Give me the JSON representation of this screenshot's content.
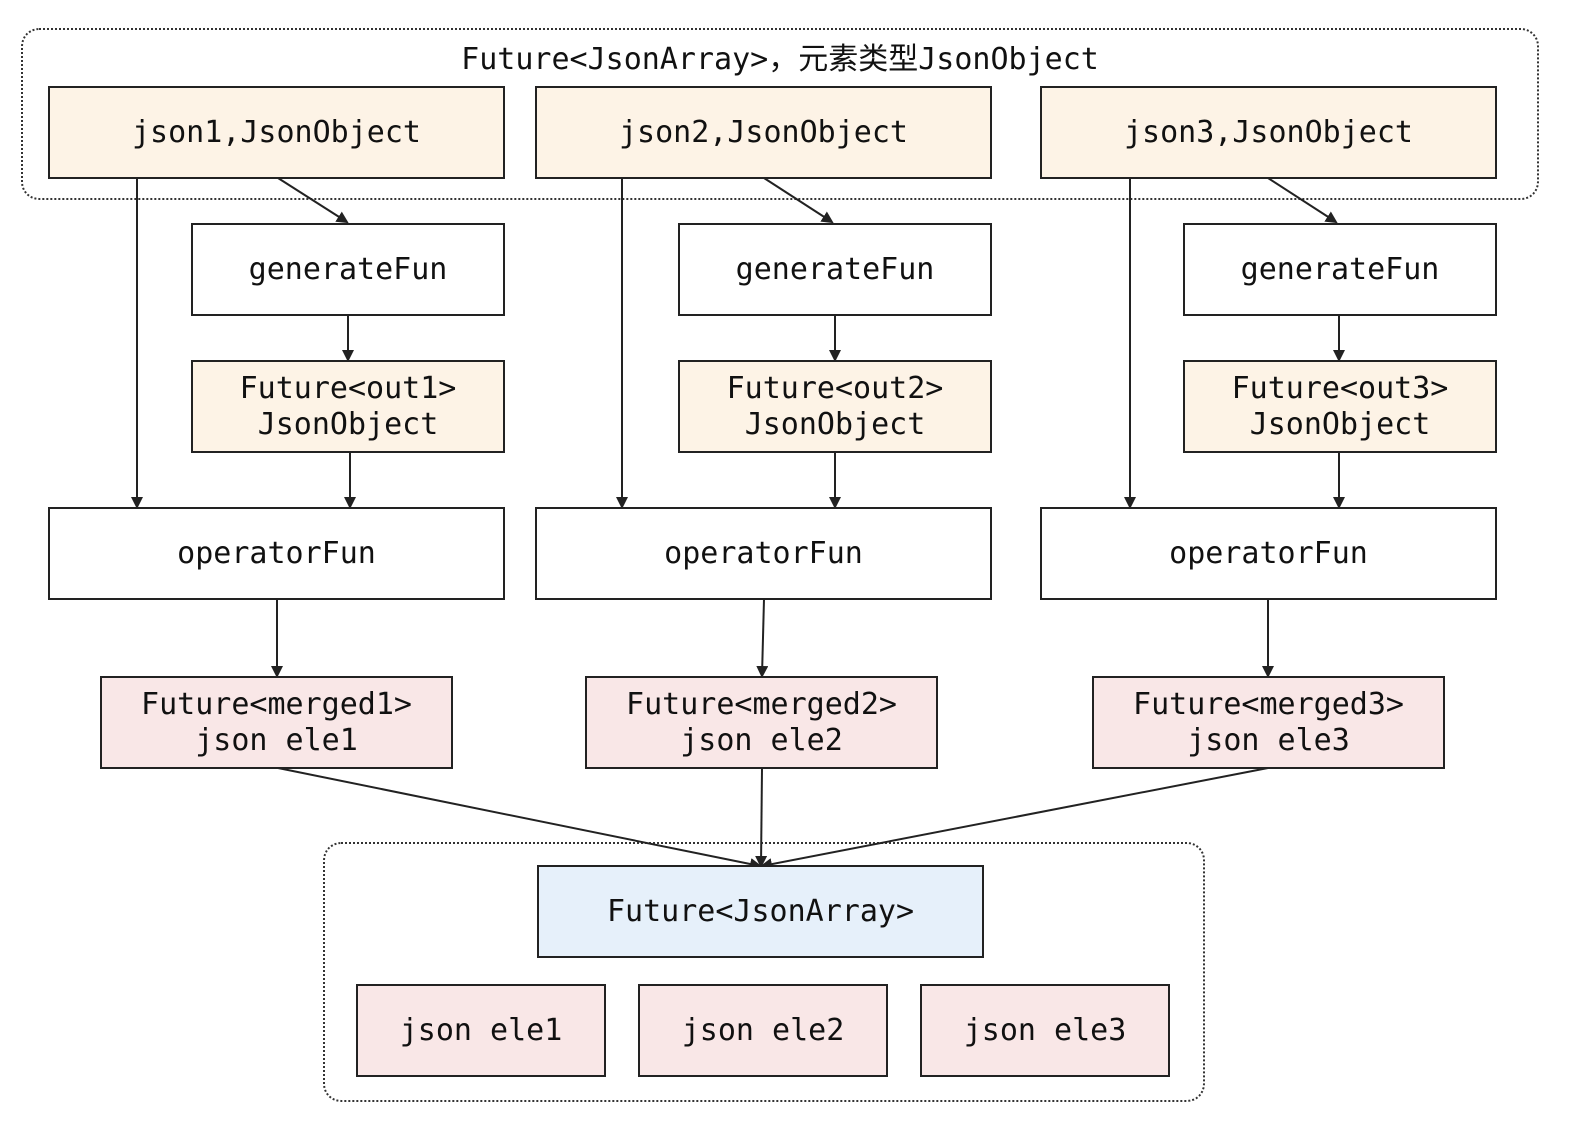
{
  "top_group": {
    "title": "Future<JsonArray>，元素类型JsonObject"
  },
  "columns": [
    {
      "input": "json1,JsonObject",
      "generate": "generateFun",
      "future_out": [
        "Future<out1>",
        "JsonObject"
      ],
      "operator": "operatorFun",
      "merged": [
        "Future<merged1>",
        "json ele1"
      ]
    },
    {
      "input": "json2,JsonObject",
      "generate": "generateFun",
      "future_out": [
        "Future<out2>",
        "JsonObject"
      ],
      "operator": "operatorFun",
      "merged": [
        "Future<merged2>",
        "json ele2"
      ]
    },
    {
      "input": "json3,JsonObject",
      "generate": "generateFun",
      "future_out": [
        "Future<out3>",
        "JsonObject"
      ],
      "operator": "operatorFun",
      "merged": [
        "Future<merged3>",
        "json ele3"
      ]
    }
  ],
  "result": {
    "title": "Future<JsonArray>",
    "elements": [
      "json ele1",
      "json ele2",
      "json ele3"
    ]
  },
  "colors": {
    "input_fill": "#fdf3e6",
    "future_fill": "#fdf3e6",
    "merged_fill": "#f9e7e7",
    "result_fill": "#e6f0fa",
    "stroke": "#222222"
  }
}
